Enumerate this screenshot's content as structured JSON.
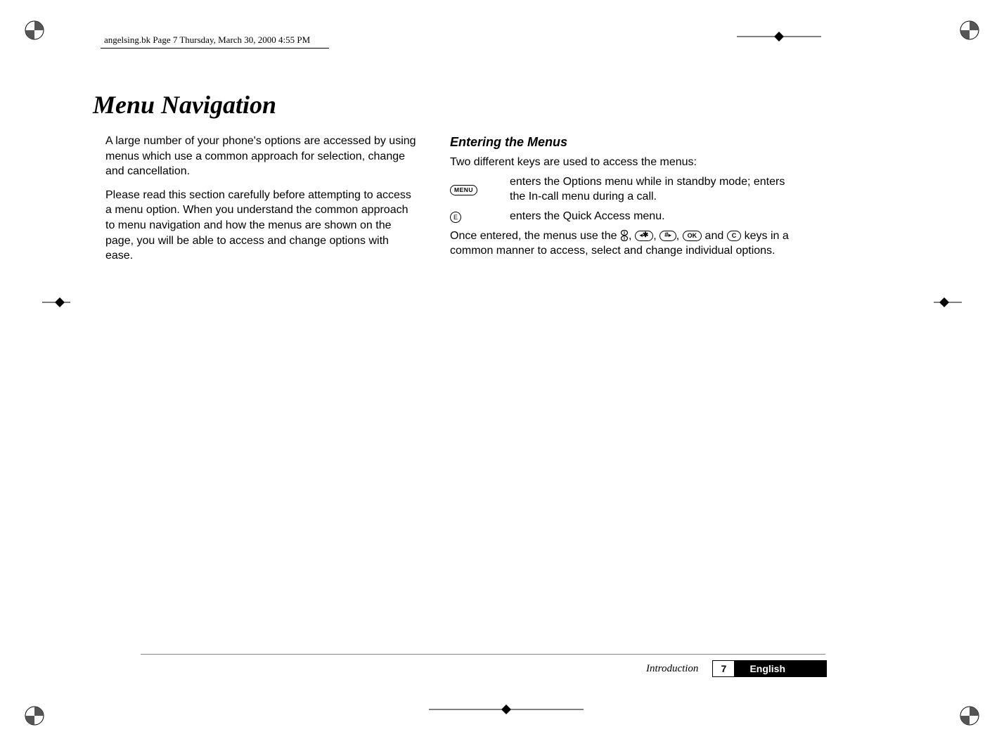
{
  "header": {
    "running_head": "angelsing.bk  Page 7  Thursday, March 30, 2000  4:55 PM"
  },
  "title": "Menu Navigation",
  "left_column": {
    "p1": "A large number of your phone's options are accessed by using menus which use a common approach for selection, change and cancellation.",
    "p2": "Please read this section carefully before attempting to access a menu option. When you understand the common approach to menu navigation and how the menus are shown on the page, you will be able to access and change options with ease."
  },
  "right_column": {
    "heading": "Entering the Menus",
    "intro": "Two different keys are used to access the menus:",
    "rows": [
      {
        "key_label": "MENU",
        "text": "enters the Options menu while in standby mode; enters the In-call menu during a call."
      },
      {
        "key_label": "E",
        "text": "enters the Quick Access menu."
      }
    ],
    "closing_pre": "Once entered, the menus use the ",
    "closing_mid1": ", ",
    "closing_mid2": ", ",
    "closing_mid3": ", ",
    "closing_mid4": " and ",
    "closing_label_star": "✱",
    "closing_label_hash": "#",
    "closing_label_ok": "OK",
    "closing_label_c": "C",
    "closing_post": " keys in a common manner to access, select and change individual options."
  },
  "footer": {
    "section": "Introduction",
    "page": "7",
    "language": "English"
  }
}
